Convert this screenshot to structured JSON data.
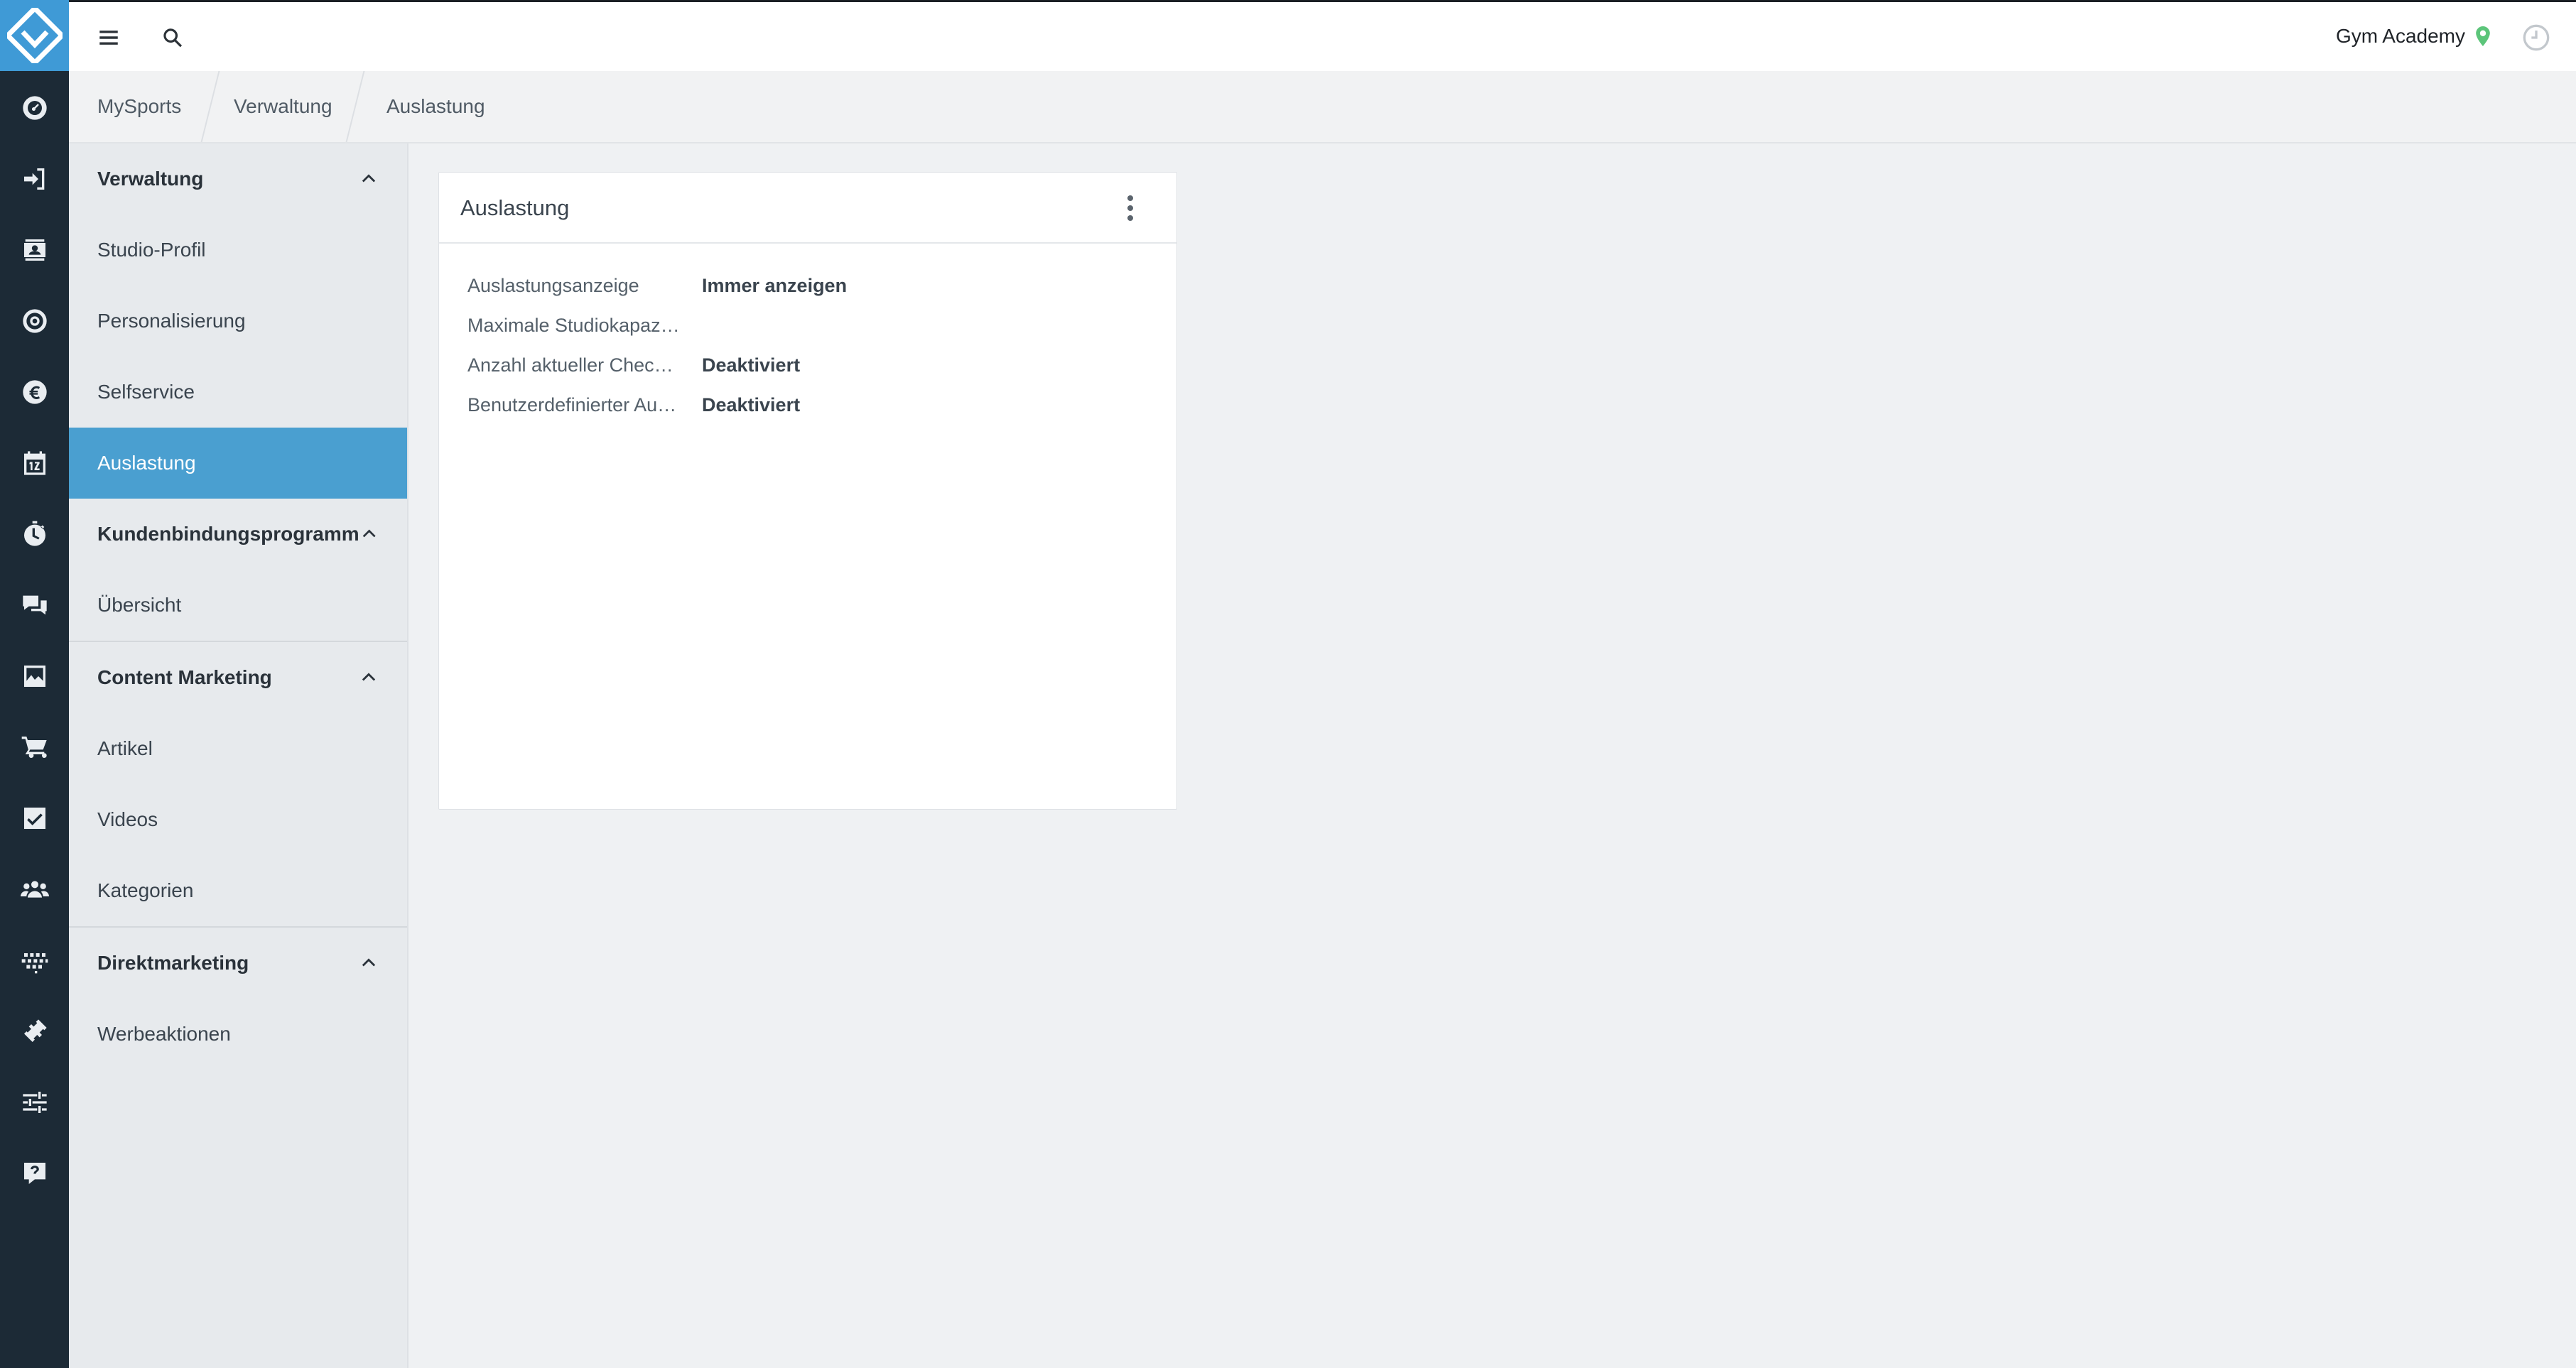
{
  "app": {
    "logo_icon": "mysports-diamond-logo",
    "accent_color": "#3f9ad6",
    "rail_color": "#1c2a36"
  },
  "rail": {
    "icons": [
      "dashboard-icon",
      "checkin-icon",
      "contacts-icon",
      "settings-icon",
      "euro-icon",
      "calendar-icon",
      "timer-icon",
      "chat-icon",
      "image-icon",
      "cart-icon",
      "checkbox-icon",
      "group-icon",
      "heart-rate-icon",
      "fitness-icon",
      "sliders-icon",
      "help-icon"
    ]
  },
  "topbar": {
    "menu_icon": "hamburger-icon",
    "search_icon": "search-icon",
    "studio_name": "Gym Academy",
    "location_icon": "map-pin-icon",
    "location_color": "#5cc57a",
    "clock_icon": "clock-icon"
  },
  "breadcrumb": [
    "MySports",
    "Verwaltung",
    "Auslastung"
  ],
  "sidebar": {
    "sections": [
      {
        "title": "Verwaltung",
        "items": [
          "Studio-Profil",
          "Personalisierung",
          "Selfservice",
          "Auslastung"
        ]
      },
      {
        "title": "Kundenbindungsprogramm",
        "items": [
          "Übersicht"
        ]
      },
      {
        "title": "Content Marketing",
        "items": [
          "Artikel",
          "Videos",
          "Kategorien"
        ]
      },
      {
        "title": "Direktmarketing",
        "items": [
          "Werbeaktionen"
        ]
      }
    ],
    "active_item": "Auslastung"
  },
  "card": {
    "title": "Auslastung",
    "rows": [
      {
        "label": "Auslastungsanzeige",
        "value": "Immer anzeigen"
      },
      {
        "label": "Maximale Studiokapazi…",
        "value": ""
      },
      {
        "label": "Anzahl aktueller Check-…",
        "value": "Deaktiviert"
      },
      {
        "label": "Benutzerdefinierter Au…",
        "value": "Deaktiviert"
      }
    ]
  }
}
